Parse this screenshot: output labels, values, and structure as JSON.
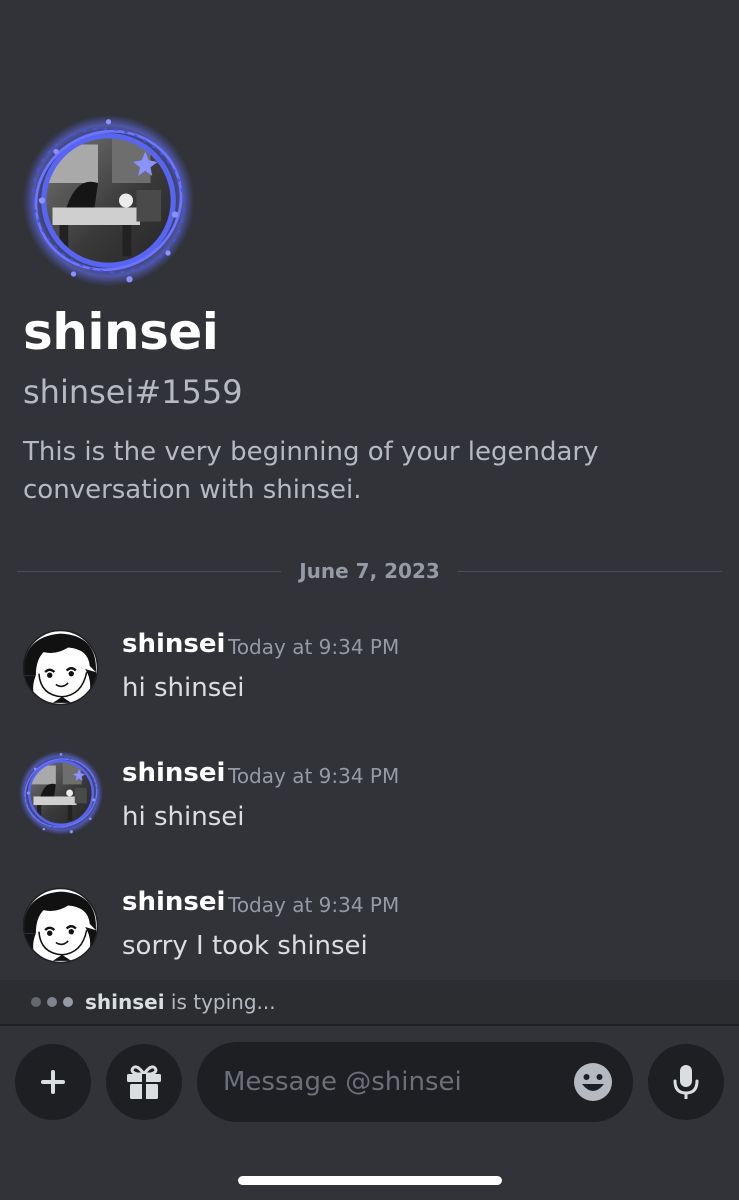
{
  "profile": {
    "display_name": "shinsei",
    "tag": "shinsei#1559",
    "intro": "This is the very beginning of your legendary conversation with shinsei."
  },
  "divider": {
    "date": "June 7, 2023"
  },
  "messages": [
    {
      "author": "shinsei",
      "time": "Today at 9:34 PM",
      "text": "hi shinsei",
      "avatar": "manga-girl-avatar"
    },
    {
      "author": "shinsei",
      "time": "Today at 9:34 PM",
      "text": "hi shinsei",
      "avatar": "purple-ring-room-avatar"
    },
    {
      "author": "shinsei",
      "time": "Today at 9:34 PM",
      "text": "sorry I took shinsei",
      "avatar": "manga-girl-avatar"
    }
  ],
  "typing": {
    "user": "shinsei",
    "suffix": " is typing..."
  },
  "composer": {
    "placeholder": "Message @shinsei",
    "icons": [
      "plus-icon",
      "gift-icon",
      "emoji-icon",
      "microphone-icon"
    ]
  },
  "colors": {
    "background": "#313338",
    "accent_ring": "#5865f2",
    "input_bg": "#1e1f22",
    "muted_text": "#949ba4"
  }
}
